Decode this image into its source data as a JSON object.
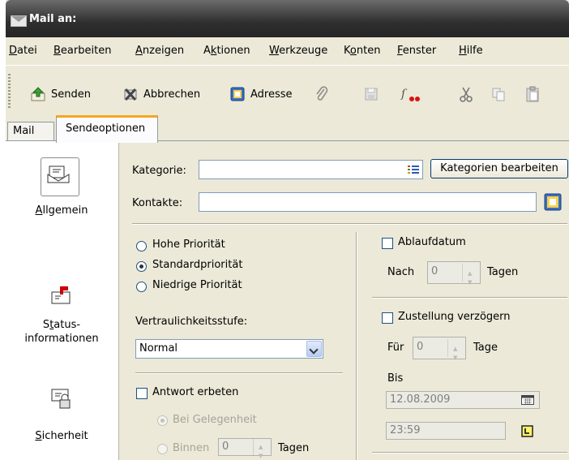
{
  "window": {
    "title": "Mail an:"
  },
  "menu": [
    {
      "pre": "",
      "acc": "D",
      "post": "atei"
    },
    {
      "pre": "",
      "acc": "B",
      "post": "earbeiten"
    },
    {
      "pre": "",
      "acc": "A",
      "post": "nzeigen"
    },
    {
      "pre": "A",
      "acc": "k",
      "post": "tionen"
    },
    {
      "pre": "",
      "acc": "W",
      "post": "erkzeuge"
    },
    {
      "pre": "K",
      "acc": "o",
      "post": "nten"
    },
    {
      "pre": "",
      "acc": "F",
      "post": "enster"
    },
    {
      "pre": "",
      "acc": "H",
      "post": "ilfe"
    }
  ],
  "toolbar": {
    "send": "Senden",
    "cancel": "Abbrechen",
    "address": "Adresse"
  },
  "tabs": {
    "mail": "Mail",
    "send_options": "Sendeoptionen"
  },
  "nav": {
    "general": {
      "pre": "",
      "acc": "A",
      "post": "llgemein"
    },
    "status1": {
      "pre": "S",
      "acc": "t",
      "post": "atus-"
    },
    "status2": "informationen",
    "security": {
      "pre": "",
      "acc": "S",
      "post": "icherheit"
    }
  },
  "form": {
    "category_label": "Kategorie:",
    "category_value": "",
    "edit_categories": "Kategorien bearbeiten",
    "contacts_label": "Kontakte:",
    "contacts_value": "",
    "priority_high": "Hohe Priorität",
    "priority_standard": "Standardpriorität",
    "priority_low": "Niedrige Priorität",
    "priority_selected": "standard",
    "confidentiality_label": "Vertraulichkeitsstufe:",
    "confidentiality_value": "Normal",
    "reply_requested": "Antwort erbeten",
    "reply_when_convenient": "Bei Gelegenheit",
    "reply_within": "Binnen",
    "reply_within_days": "0",
    "days_label": "Tagen",
    "expiry_label": "Ablaufdatum",
    "expiry_after": "Nach",
    "expiry_days": "0",
    "expiry_days_label": "Tagen",
    "delay_label": "Zustellung verzögern",
    "delay_for": "Für",
    "delay_days": "0",
    "delay_days_label": "Tage",
    "until_label": "Bis",
    "until_date": "12.08.2009",
    "until_time": "23:59"
  }
}
